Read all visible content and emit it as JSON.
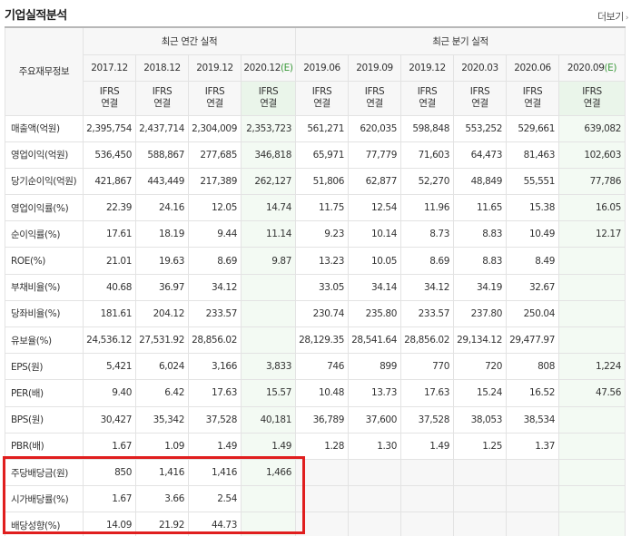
{
  "header": {
    "title": "기업실적분석",
    "more_label": "더보기"
  },
  "table": {
    "row_header_label": "주요재무정보",
    "group_annual": "최근 연간 실적",
    "group_quarter": "최근 분기 실적",
    "periods": [
      {
        "label": "2017.12",
        "est": ""
      },
      {
        "label": "2018.12",
        "est": ""
      },
      {
        "label": "2019.12",
        "est": ""
      },
      {
        "label": "2020.12",
        "est": "(E)"
      },
      {
        "label": "2019.06",
        "est": ""
      },
      {
        "label": "2019.09",
        "est": ""
      },
      {
        "label": "2019.12",
        "est": ""
      },
      {
        "label": "2020.03",
        "est": ""
      },
      {
        "label": "2020.06",
        "est": ""
      },
      {
        "label": "2020.09",
        "est": "(E)"
      }
    ],
    "basis": {
      "line1": "IFRS",
      "line2": "연결"
    },
    "rows": [
      {
        "label": "매출액(억원)",
        "values": [
          "2,395,754",
          "2,437,714",
          "2,304,009",
          "2,353,723",
          "561,271",
          "620,035",
          "598,848",
          "553,252",
          "529,661",
          "639,082"
        ]
      },
      {
        "label": "영업이익(억원)",
        "values": [
          "536,450",
          "588,867",
          "277,685",
          "346,818",
          "65,971",
          "77,779",
          "71,603",
          "64,473",
          "81,463",
          "102,603"
        ]
      },
      {
        "label": "당기순이익(억원)",
        "values": [
          "421,867",
          "443,449",
          "217,389",
          "262,127",
          "51,806",
          "62,877",
          "52,270",
          "48,849",
          "55,551",
          "77,786"
        ]
      },
      {
        "label": "영업이익률(%)",
        "values": [
          "22.39",
          "24.16",
          "12.05",
          "14.74",
          "11.75",
          "12.54",
          "11.96",
          "11.65",
          "15.38",
          "16.05"
        ]
      },
      {
        "label": "순이익률(%)",
        "values": [
          "17.61",
          "18.19",
          "9.44",
          "11.14",
          "9.23",
          "10.14",
          "8.73",
          "8.83",
          "10.49",
          "12.17"
        ]
      },
      {
        "label": "ROE(%)",
        "values": [
          "21.01",
          "19.63",
          "8.69",
          "9.87",
          "13.23",
          "10.05",
          "8.69",
          "8.83",
          "8.49",
          ""
        ]
      },
      {
        "label": "부채비율(%)",
        "values": [
          "40.68",
          "36.97",
          "34.12",
          "",
          "33.05",
          "34.14",
          "34.12",
          "34.19",
          "32.67",
          ""
        ]
      },
      {
        "label": "당좌비율(%)",
        "values": [
          "181.61",
          "204.12",
          "233.57",
          "",
          "230.74",
          "235.80",
          "233.57",
          "237.80",
          "250.04",
          ""
        ]
      },
      {
        "label": "유보율(%)",
        "values": [
          "24,536.12",
          "27,531.92",
          "28,856.02",
          "",
          "28,129.35",
          "28,541.64",
          "28,856.02",
          "29,134.12",
          "29,477.97",
          ""
        ]
      },
      {
        "label": "EPS(원)",
        "values": [
          "5,421",
          "6,024",
          "3,166",
          "3,833",
          "746",
          "899",
          "770",
          "720",
          "808",
          "1,224"
        ]
      },
      {
        "label": "PER(배)",
        "values": [
          "9.40",
          "6.42",
          "17.63",
          "15.57",
          "10.48",
          "13.73",
          "17.63",
          "15.24",
          "16.52",
          "47.56"
        ]
      },
      {
        "label": "BPS(원)",
        "values": [
          "30,427",
          "35,342",
          "37,528",
          "40,181",
          "36,789",
          "37,600",
          "37,528",
          "38,053",
          "38,534",
          ""
        ]
      },
      {
        "label": "PBR(배)",
        "values": [
          "1.67",
          "1.09",
          "1.49",
          "1.49",
          "1.28",
          "1.30",
          "1.49",
          "1.25",
          "1.37",
          ""
        ]
      },
      {
        "label": "주당배당금(원)",
        "values": [
          "850",
          "1,416",
          "1,416",
          "1,466",
          "",
          "",
          "",
          "",
          "",
          ""
        ]
      },
      {
        "label": "시가배당률(%)",
        "values": [
          "1.67",
          "3.66",
          "2.54",
          "",
          "",
          "",
          "",
          "",
          "",
          ""
        ]
      },
      {
        "label": "배당성향(%)",
        "values": [
          "14.09",
          "21.92",
          "44.73",
          "",
          "",
          "",
          "",
          "",
          "",
          ""
        ]
      }
    ]
  },
  "highlight": {
    "color": "#e01e1e"
  },
  "colors": {
    "ifrs": "#e8641d",
    "estimate": "#3a9a3a",
    "estimate_bg": "#f3faf3"
  }
}
